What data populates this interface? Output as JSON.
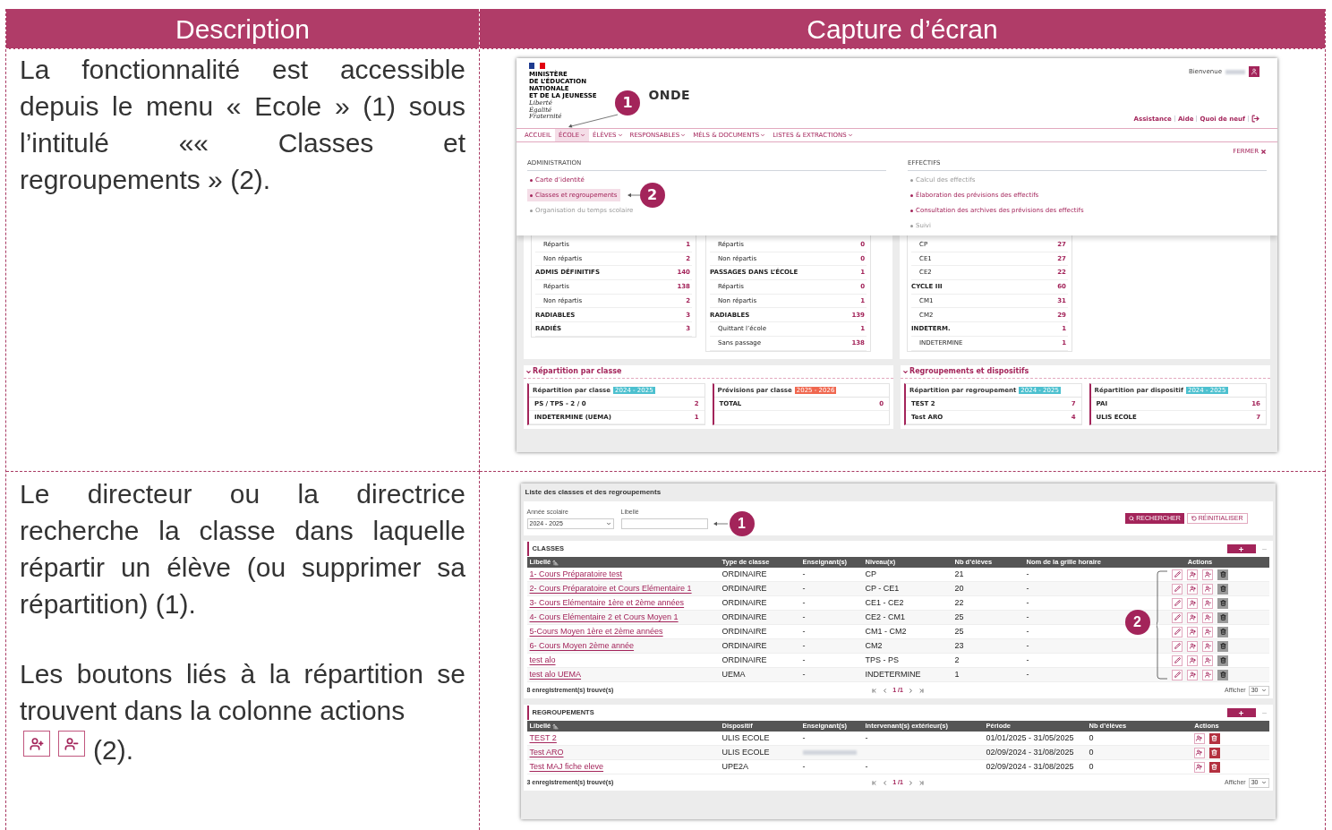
{
  "header": [
    "Description",
    "Capture d’écran"
  ],
  "row_1": {
    "paragraph": "La fonctionnalité est accessible depuis le menu « Ecole » (1) sous l’intitulé «« Classes et regroupements » (2).",
    "screenshot": {
      "logo_lines": [
        "MINISTÈRE",
        "DE L’ÉDUCATION",
        "NATIONALE",
        "ET DE LA JEUNESSE"
      ],
      "motto": [
        "Liberté",
        "Égalité",
        "Fraternité"
      ],
      "title": "ONDE",
      "welcome": "Bienvenue",
      "links": [
        "Assistance",
        "Aide",
        "Quoi de neuf"
      ],
      "nav": [
        {
          "label": "ACCUEIL",
          "dropdown": false,
          "selected": false
        },
        {
          "label": "ÉCOLE",
          "dropdown": true,
          "selected": true
        },
        {
          "label": "ÉLÈVES",
          "dropdown": true,
          "selected": false
        },
        {
          "label": "RESPONSABLES",
          "dropdown": true,
          "selected": false
        },
        {
          "label": "MÉLS & DOCUMENTS",
          "dropdown": true,
          "selected": false
        },
        {
          "label": "LISTES & EXTRACTIONS",
          "dropdown": true,
          "selected": false
        }
      ],
      "close": "FERMER",
      "menu_columns": [
        {
          "title": "ADMINISTRATION",
          "items": [
            {
              "label": "Carte d’identité",
              "disabled": false,
              "selected": false
            },
            {
              "label": "Classes et regroupements",
              "disabled": false,
              "selected": true
            },
            {
              "label": "Organisation du temps scolaire",
              "disabled": true,
              "selected": false
            }
          ]
        },
        {
          "title": "EFFECTIFS",
          "items": [
            {
              "label": "Calcul des effectifs",
              "disabled": true,
              "selected": false
            },
            {
              "label": "Élaboration des prévisions des effectifs",
              "disabled": false,
              "selected": false
            },
            {
              "label": "Consultation des archives des prévisions des effectifs",
              "disabled": false,
              "selected": false
            },
            {
              "label": "Suivi",
              "disabled": true,
              "selected": false
            }
          ]
        }
      ],
      "callouts": [
        "1",
        "2"
      ],
      "stat_cards": [
        {
          "rows": [
            {
              "label": "Répartis",
              "value": "1",
              "bold": false
            },
            {
              "label": "Non répartis",
              "value": "2",
              "bold": false
            },
            {
              "label": "ADMIS DÉFINITIFS",
              "value": "140",
              "bold": true
            },
            {
              "label": "Répartis",
              "value": "138",
              "bold": false
            },
            {
              "label": "Non répartis",
              "value": "2",
              "bold": false
            },
            {
              "label": "RADIABLES",
              "value": "3",
              "bold": true
            },
            {
              "label": "RADIÉS",
              "value": "3",
              "bold": true
            }
          ]
        },
        {
          "rows": [
            {
              "label": "Répartis",
              "value": "0",
              "bold": false
            },
            {
              "label": "Non répartis",
              "value": "0",
              "bold": false
            },
            {
              "label": "PASSAGES DANS L’ÉCOLE",
              "value": "1",
              "bold": true
            },
            {
              "label": "Répartis",
              "value": "0",
              "bold": false
            },
            {
              "label": "Non répartis",
              "value": "1",
              "bold": false
            },
            {
              "label": "RADIABLES",
              "value": "139",
              "bold": true
            },
            {
              "label": "Quittant l’école",
              "value": "1",
              "bold": false
            },
            {
              "label": "Sans passage",
              "value": "138",
              "bold": false
            }
          ]
        },
        {
          "rows": [
            {
              "label": "CP",
              "value": "27",
              "bold": false
            },
            {
              "label": "CE1",
              "value": "27",
              "bold": false
            },
            {
              "label": "CE2",
              "value": "22",
              "bold": false
            },
            {
              "label": "CYCLE III",
              "value": "60",
              "bold": true
            },
            {
              "label": "CM1",
              "value": "31",
              "bold": false
            },
            {
              "label": "CM2",
              "value": "29",
              "bold": false
            },
            {
              "label": "INDETERM.",
              "value": "1",
              "bold": true
            },
            {
              "label": "INDETERMINE",
              "value": "1",
              "bold": false
            }
          ]
        }
      ],
      "sections": [
        {
          "title": "Répartition par classe",
          "cards": [
            {
              "title": "Répartition par classe",
              "tag": "2024 - 2025",
              "color": "#4cc0cf",
              "rows": [
                {
                  "label": "PS / TPS - 2 / 0",
                  "value": "2"
                },
                {
                  "label": "INDETERMINE (UEMA)",
                  "value": "1"
                }
              ]
            },
            {
              "title": "Prévisions par classe",
              "tag": "2025 - 2026",
              "color": "#f0674f",
              "rows": [
                {
                  "label": "TOTAL",
                  "value": "0"
                }
              ]
            }
          ]
        },
        {
          "title": "Regroupements et dispositifs",
          "cards": [
            {
              "title": "Répartition par regroupement",
              "tag": "2024 - 2025",
              "color": "#4cc0cf",
              "rows": [
                {
                  "label": "TEST 2",
                  "value": "7"
                },
                {
                  "label": "Test ARO",
                  "value": "4"
                }
              ]
            },
            {
              "title": "Répartition par dispositif",
              "tag": "2024 - 2025",
              "color": "#4cc0cf",
              "rows": [
                {
                  "label": "PAI",
                  "value": "16"
                },
                {
                  "label": "ULIS ECOLE",
                  "value": "7"
                }
              ]
            }
          ]
        }
      ]
    }
  },
  "row_2": {
    "paragraphs": [
      "Le directeur ou la directrice recherche la classe dans laquelle répartir un élève (ou supprimer sa répartition) (1).",
      "Les boutons liés à la répartition se trouvent dans la colonne actions"
    ],
    "icon_note": "(2).",
    "screenshot": {
      "title": "Liste des classes et des regroupements",
      "filters": [
        {
          "label": "Année scolaire",
          "kind": "select",
          "value": "2024 - 2025"
        },
        {
          "label": "Libellé",
          "kind": "text"
        }
      ],
      "buttons": [
        {
          "label": "RECHERCHER",
          "kind": "primary"
        },
        {
          "label": "RÉINITIALISER",
          "kind": "secondary"
        }
      ],
      "callouts": [
        "1",
        "2"
      ],
      "tables": [
        {
          "title": "CLASSES",
          "columns": [
            "Libellé",
            "Type de classe",
            "Enseignant(s)",
            "Niveau(x)",
            "Nb d’élèves",
            "Nom de la grille horaire",
            "Actions"
          ],
          "rows": [
            {
              "cells": [
                "1- Cours Préparatoire test",
                "ORDINAIRE",
                "-",
                "CP",
                "21",
                "-"
              ],
              "actions": [
                {
                  "kind": "edit"
                },
                {
                  "kind": "assign"
                },
                {
                  "kind": "unassign"
                },
                {
                  "kind": "delete-off"
                }
              ]
            },
            {
              "cells": [
                "2- Cours Préparatoire et Cours Elémentaire 1",
                "ORDINAIRE",
                "-",
                "CP - CE1",
                "20",
                "-"
              ],
              "actions": [
                {
                  "kind": "edit"
                },
                {
                  "kind": "assign"
                },
                {
                  "kind": "unassign"
                },
                {
                  "kind": "delete-off"
                }
              ]
            },
            {
              "cells": [
                "3- Cours Elémentaire 1ère et 2ème années",
                "ORDINAIRE",
                "-",
                "CE1 - CE2",
                "22",
                "-"
              ],
              "actions": [
                {
                  "kind": "edit"
                },
                {
                  "kind": "assign"
                },
                {
                  "kind": "unassign"
                },
                {
                  "kind": "delete-off"
                }
              ]
            },
            {
              "cells": [
                "4- Cours Elémentaire 2 et Cours Moyen 1",
                "ORDINAIRE",
                "-",
                "CE2 - CM1",
                "25",
                "-"
              ],
              "actions": [
                {
                  "kind": "edit"
                },
                {
                  "kind": "assign"
                },
                {
                  "kind": "unassign"
                },
                {
                  "kind": "delete-off"
                }
              ]
            },
            {
              "cells": [
                "5-Cours Moyen 1ère et 2ème années",
                "ORDINAIRE",
                "-",
                "CM1 - CM2",
                "25",
                "-"
              ],
              "actions": [
                {
                  "kind": "edit"
                },
                {
                  "kind": "assign"
                },
                {
                  "kind": "unassign"
                },
                {
                  "kind": "delete-off"
                }
              ]
            },
            {
              "cells": [
                "6- Cours Moyen 2ème année",
                "ORDINAIRE",
                "-",
                "CM2",
                "23",
                "-"
              ],
              "actions": [
                {
                  "kind": "edit"
                },
                {
                  "kind": "assign"
                },
                {
                  "kind": "unassign"
                },
                {
                  "kind": "delete-off"
                }
              ]
            },
            {
              "cells": [
                "test alo",
                "ORDINAIRE",
                "-",
                "TPS - PS",
                "2",
                "-"
              ],
              "actions": [
                {
                  "kind": "edit"
                },
                {
                  "kind": "assign"
                },
                {
                  "kind": "unassign"
                },
                {
                  "kind": "delete-off"
                }
              ]
            },
            {
              "cells": [
                "test alo UEMA",
                "UEMA",
                "-",
                "INDETERMINE",
                "1",
                "-"
              ],
              "actions": [
                {
                  "kind": "edit"
                },
                {
                  "kind": "assign"
                },
                {
                  "kind": "unassign"
                },
                {
                  "kind": "delete-off"
                }
              ]
            }
          ],
          "count": "8 enregistrement(s) trouvé(s)",
          "page": "1 /1",
          "show_label": "Afficher",
          "page_size": "30"
        },
        {
          "title": "REGROUPEMENTS",
          "columns": [
            "Libellé",
            "Dispositif",
            "Enseignant(s)",
            "Intervenant(s) extérieur(s)",
            "Période",
            "Nb d’élèves",
            "Actions"
          ],
          "rows": [
            {
              "cells": [
                "TEST 2",
                "ULIS ECOLE",
                "-",
                "-",
                "01/01/2025 - 31/05/2025",
                "0"
              ],
              "actions": [
                {
                  "kind": "assign"
                },
                {
                  "kind": "delete"
                }
              ]
            },
            {
              "cells": [
                "Test ARO",
                "ULIS ECOLE",
                {
                  "redacted": true
                },
                null,
                "02/09/2024 - 31/08/2025",
                "0"
              ],
              "actions": [
                {
                  "kind": "assign"
                },
                {
                  "kind": "delete"
                }
              ]
            },
            {
              "cells": [
                "Test MAJ fiche eleve",
                "UPE2A",
                "-",
                "-",
                "02/09/2024 - 31/08/2025",
                "0"
              ],
              "actions": [
                {
                  "kind": "assign"
                },
                {
                  "kind": "delete"
                }
              ]
            }
          ],
          "count": "3 enregistrement(s) trouvé(s)",
          "page": "1 /1",
          "show_label": "Afficher",
          "page_size": "30"
        }
      ]
    }
  }
}
